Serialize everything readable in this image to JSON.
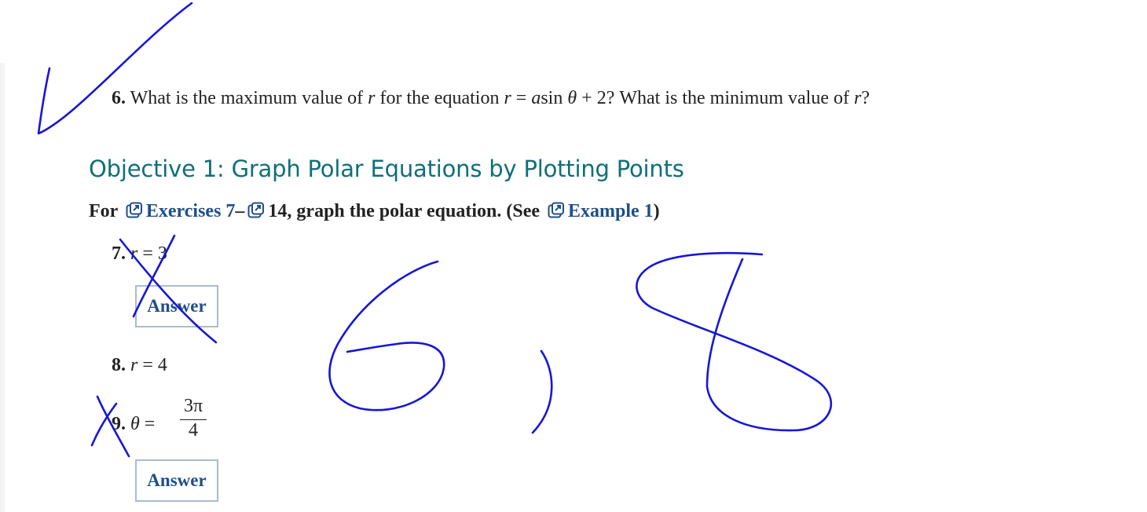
{
  "question6": {
    "number": "6.",
    "text_a": " What is the maximum value of ",
    "var_r": "r",
    "text_b": " for the equation ",
    "eq_r": "r",
    "eq_eq": " = ",
    "eq_a": "a",
    "eq_sin": "sin ",
    "eq_theta": "θ",
    "eq_plus": " + 2",
    "text_c": "? What is the minimum value of ",
    "var_r2": "r",
    "text_d": "?"
  },
  "objective": {
    "title": "Objective 1: Graph Polar Equations by Plotting Points"
  },
  "instructions": {
    "for": "For",
    "exercises_link": "Exercises 7",
    "dash": "–",
    "end_link": "14",
    "rest": ", graph the polar equation. (See",
    "example_link": "Example 1",
    "close": ")"
  },
  "exercises": [
    {
      "number": "7.",
      "var": "r",
      "eq": " = 3"
    },
    {
      "number": "8.",
      "var": "r",
      "eq": " = 4"
    },
    {
      "number": "9.",
      "var": "θ",
      "eq": " = ",
      "numerator": "3π",
      "denominator": "4"
    }
  ],
  "answer_buttons": {
    "label_7": "Answer",
    "label_9": "Answer"
  },
  "handwriting": {
    "answer_text": "6, 8",
    "color": "#1616d9"
  }
}
